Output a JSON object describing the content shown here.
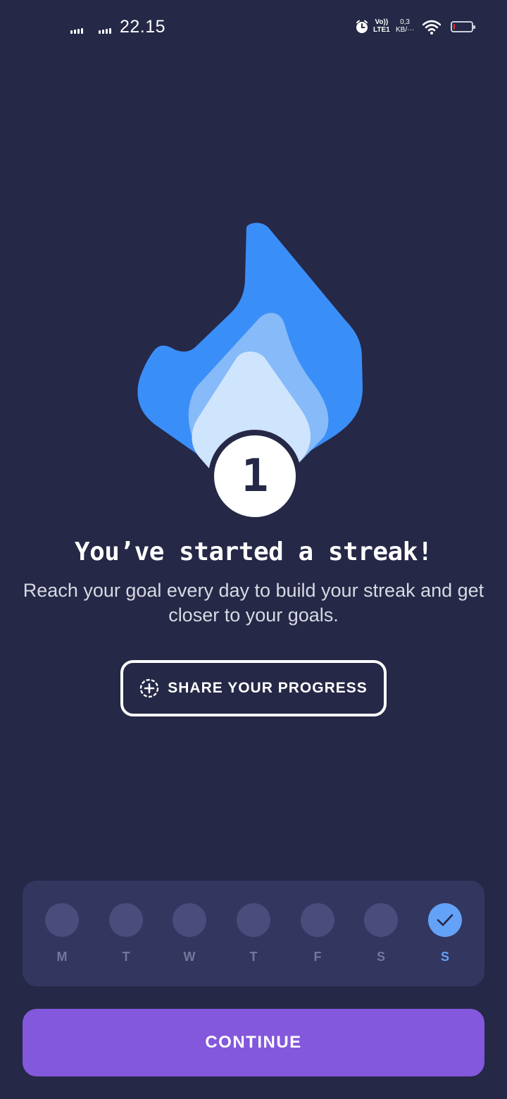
{
  "status_bar": {
    "time": "22.15",
    "volte": "Vo))",
    "lte": "LTE1",
    "net_speed_value": "0,3",
    "net_speed_unit": "KB/···",
    "battery_level_percent": 10,
    "battery_color": "#e0312e",
    "icons": [
      "signal-icon",
      "alarm-icon",
      "wifi-icon",
      "battery-icon"
    ]
  },
  "streak": {
    "count": "1",
    "flame_colors": [
      "#3a8ef8",
      "#86baf9",
      "#cfe4fd"
    ]
  },
  "main": {
    "title": "You’ve started a streak!",
    "subtitle": "Reach your goal every day to build your streak and get closer to your goals.",
    "share_button_label": "SHARE YOUR PROGRESS",
    "share_icon": "add-circle-icon"
  },
  "week": {
    "days": [
      {
        "label": "M",
        "done": false
      },
      {
        "label": "T",
        "done": false
      },
      {
        "label": "W",
        "done": false
      },
      {
        "label": "T",
        "done": false
      },
      {
        "label": "F",
        "done": false
      },
      {
        "label": "S",
        "done": false
      },
      {
        "label": "S",
        "done": true
      }
    ]
  },
  "footer": {
    "continue_label": "CONTINUE"
  },
  "colors": {
    "background": "#252846",
    "card": "#33365f",
    "accent_blue": "#64a2f8",
    "button_purple": "#8358dc"
  }
}
